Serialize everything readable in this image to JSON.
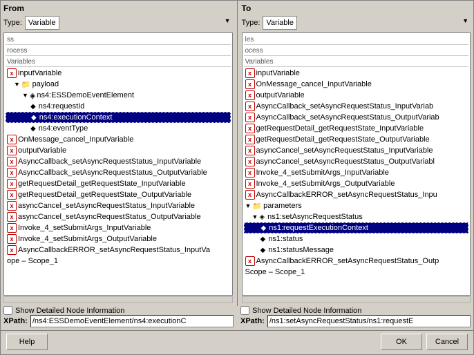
{
  "from": {
    "title": "From",
    "type_label": "Type:",
    "type_value": "Variable",
    "tree_headers": [
      "ss",
      "rocess"
    ],
    "tree_section": "Variables",
    "items": [
      {
        "id": "inputVariable",
        "level": 0,
        "type": "var",
        "label": "inputVariable"
      },
      {
        "id": "payload",
        "level": 1,
        "type": "folder",
        "label": "payload"
      },
      {
        "id": "ns4ESSDemo",
        "level": 2,
        "type": "folder",
        "label": "ns4:ESSDemoEventElement"
      },
      {
        "id": "ns4requestId",
        "level": 3,
        "type": "diamond",
        "label": "ns4:requestId"
      },
      {
        "id": "ns4executionContext",
        "level": 3,
        "type": "diamond",
        "label": "ns4:executionContext",
        "selected": true
      },
      {
        "id": "ns4eventType",
        "level": 3,
        "type": "diamond",
        "label": "ns4:eventType"
      },
      {
        "id": "OnMessage_cancel",
        "level": 0,
        "type": "var",
        "label": "OnMessage_cancel_InputVariable"
      },
      {
        "id": "outputVariable",
        "level": 0,
        "type": "var",
        "label": "outputVariable"
      },
      {
        "id": "AsyncCallback_set_In",
        "level": 0,
        "type": "var",
        "label": "AsyncCallback_setAsyncRequestStatus_InputVariable"
      },
      {
        "id": "AsyncCallback_set_Out",
        "level": 0,
        "type": "var",
        "label": "AsyncCallback_setAsyncRequestStatus_OutputVariable"
      },
      {
        "id": "getRequestDetail_In",
        "level": 0,
        "type": "var",
        "label": "getRequestDetail_getRequestState_InputVariable"
      },
      {
        "id": "getRequestDetail_Out",
        "level": 0,
        "type": "var",
        "label": "getRequestDetail_getRequestState_OutputVariable"
      },
      {
        "id": "asyncCancel_In",
        "level": 0,
        "type": "var",
        "label": "asyncCancel_setAsyncRequestStatus_InputVariable"
      },
      {
        "id": "asyncCancel_Out",
        "level": 0,
        "type": "var",
        "label": "asyncCancel_setAsyncRequestStatus_OutputVariable"
      },
      {
        "id": "Invoke_4_In",
        "level": 0,
        "type": "var",
        "label": "Invoke_4_setSubmitArgs_InputVariable"
      },
      {
        "id": "Invoke_4_Out",
        "level": 0,
        "type": "var",
        "label": "Invoke_4_setSubmitArgs_OutputVariable"
      },
      {
        "id": "AsyncCallbackERROR",
        "level": 0,
        "type": "var",
        "label": "AsyncCallbackERROR_setAsyncRequestStatus_InputVa"
      },
      {
        "id": "scope1",
        "level": 0,
        "type": "plain",
        "label": "ope – Scope_1"
      }
    ],
    "checkbox_label": "Show Detailed Node Information",
    "xpath_label": "XPath:",
    "xpath_value": "/ns4:ESSDemoEventElement/ns4:executionC"
  },
  "to": {
    "title": "To",
    "type_label": "Type:",
    "type_value": "Variable",
    "tree_headers": [
      "les",
      "ocess"
    ],
    "tree_section": "Variables",
    "items": [
      {
        "id": "inputVariable",
        "level": 0,
        "type": "var",
        "label": "inputVariable"
      },
      {
        "id": "OnMessage_cancel",
        "level": 0,
        "type": "var",
        "label": "OnMessage_cancel_InputVariable"
      },
      {
        "id": "outputVariable",
        "level": 0,
        "type": "var",
        "label": "outputVariable"
      },
      {
        "id": "AsyncCallback_set_In",
        "level": 0,
        "type": "var",
        "label": "AsyncCallback_setAsyncRequestStatus_InputVariab"
      },
      {
        "id": "AsyncCallback_set_Out",
        "level": 0,
        "type": "var",
        "label": "AsyncCallback_setAsyncRequestStatus_OutputVariab"
      },
      {
        "id": "getRequestDetail_In",
        "level": 0,
        "type": "var",
        "label": "getRequestDetail_getRequestState_InputVariable"
      },
      {
        "id": "getRequestDetail_Out",
        "level": 0,
        "type": "var",
        "label": "getRequestDetail_getRequestState_OutputVariable"
      },
      {
        "id": "asyncCancel_In",
        "level": 0,
        "type": "var",
        "label": "asyncCancel_setAsyncRequestStatus_InputVariable"
      },
      {
        "id": "asyncCancel_Out",
        "level": 0,
        "type": "var",
        "label": "asyncCancel_setAsyncRequestStatus_OutputVariabl"
      },
      {
        "id": "Invoke_4_In",
        "level": 0,
        "type": "var",
        "label": "Invoke_4_setSubmitArgs_InputVariable"
      },
      {
        "id": "Invoke_4_Out",
        "level": 0,
        "type": "var",
        "label": "Invoke_4_setSubmitArgs_OutputVariable"
      },
      {
        "id": "AsyncCallbackERROR",
        "level": 0,
        "type": "var",
        "label": "AsyncCallbackERROR_setAsyncRequestStatus_Inpu"
      },
      {
        "id": "parameters",
        "level": 0,
        "type": "folder",
        "label": "parameters"
      },
      {
        "id": "ns1setAsync",
        "level": 1,
        "type": "folder",
        "label": "ns1:setAsyncRequestStatus"
      },
      {
        "id": "ns1requestExec",
        "level": 2,
        "type": "diamond",
        "label": "ns1:requestExecutionContext",
        "selected": true
      },
      {
        "id": "ns1status",
        "level": 2,
        "type": "diamond",
        "label": "ns1:status"
      },
      {
        "id": "ns1statusMessage",
        "level": 2,
        "type": "diamond",
        "label": "ns1:statusMessage"
      },
      {
        "id": "AsyncCallbackERROR2",
        "level": 0,
        "type": "var",
        "label": "AsyncCallbackERROR_setAsyncRequestStatus_Outp"
      },
      {
        "id": "scope1",
        "level": 0,
        "type": "plain",
        "label": "Scope – Scope_1"
      }
    ],
    "checkbox_label": "Show Detailed Node Information",
    "xpath_label": "XPath:",
    "xpath_value": "/ns1:setAsyncRequestStatus/ns1:requestE"
  },
  "buttons": {
    "help": "Help",
    "ok": "OK",
    "cancel": "Cancel"
  }
}
